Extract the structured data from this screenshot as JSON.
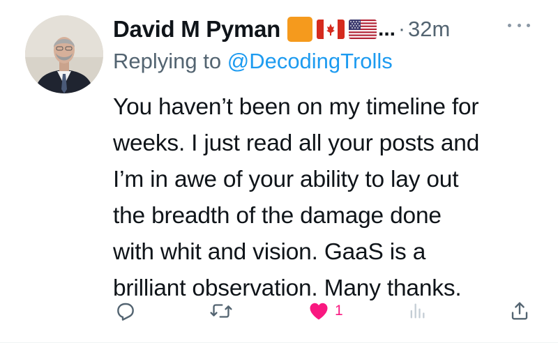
{
  "tweet": {
    "author": {
      "display_name": "David M Pyman",
      "badges": [
        "orange-square",
        "canada-flag-icon",
        "usa-flag-icon"
      ],
      "truncation": "...",
      "dot": "·",
      "timestamp": "32m"
    },
    "replying_prefix": "Replying to",
    "replying_handle": "@DecodingTrolls",
    "text_lines": [
      "You haven’t been on my timeline for",
      "weeks. I just read all your posts and",
      "I’m in awe of your ability to lay out",
      "the breadth of the damage done",
      "with whit and vision. GaaS is a",
      "brilliant observation. Many thanks."
    ],
    "actions": {
      "reply_count": "",
      "retweet_count": "",
      "like_count": "1",
      "views_count": ""
    }
  },
  "colors": {
    "text": "#0f1419",
    "secondary": "#536471",
    "link": "#1d9bf0",
    "like": "#f91880",
    "orange": "#f59a1d"
  }
}
